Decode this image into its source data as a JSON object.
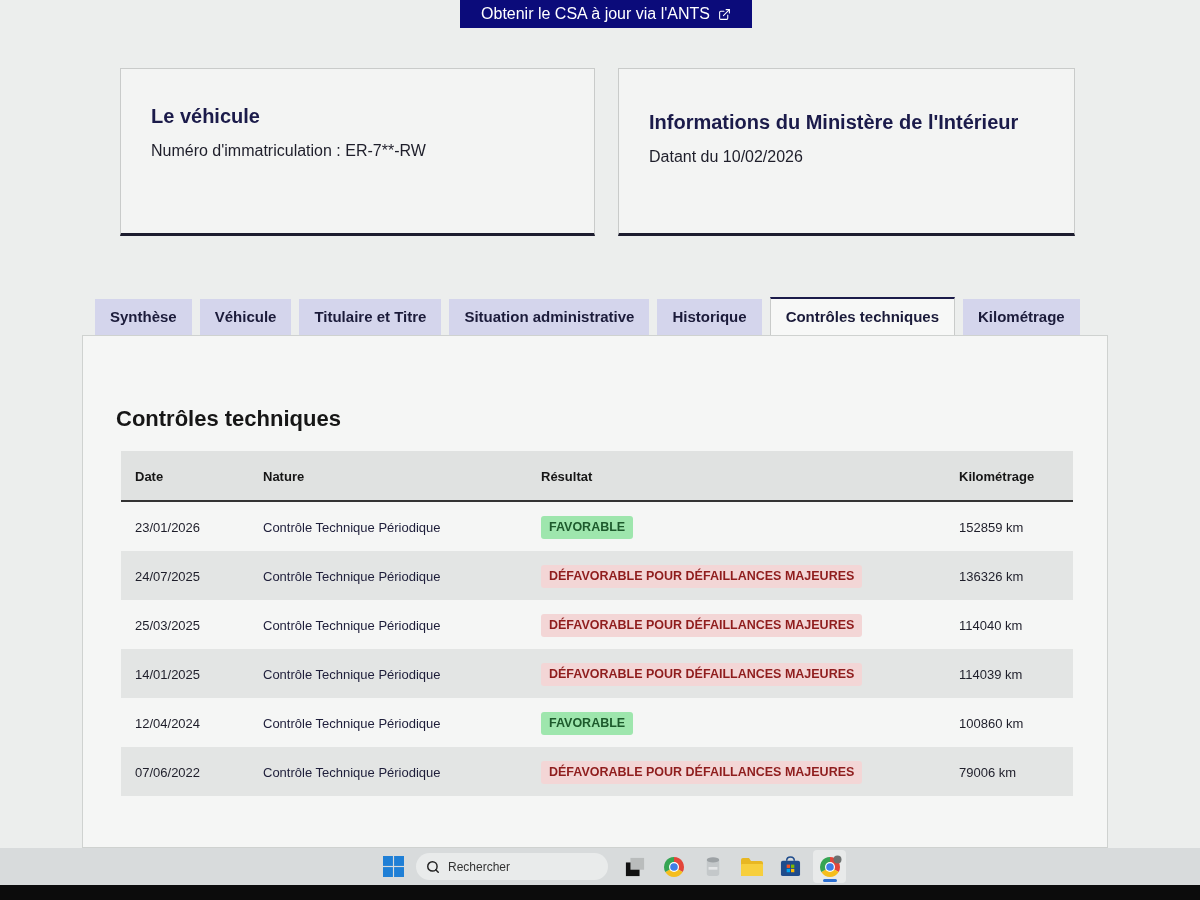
{
  "header_button": {
    "label": "Obtenir le CSA à jour via l'ANTS"
  },
  "cards": [
    {
      "title": "Le véhicule",
      "text": "Numéro d'immatriculation : ER-7**-RW"
    },
    {
      "title": "Informations du Ministère de l'Intérieur",
      "text": "Datant du 10/02/2026"
    }
  ],
  "tabs": [
    {
      "label": "Synthèse",
      "selected": false
    },
    {
      "label": "Véhicule",
      "selected": false
    },
    {
      "label": "Titulaire et Titre",
      "selected": false
    },
    {
      "label": "Situation administrative",
      "selected": false
    },
    {
      "label": "Historique",
      "selected": false
    },
    {
      "label": "Contrôles techniques",
      "selected": true
    },
    {
      "label": "Kilométrage",
      "selected": false
    }
  ],
  "panel": {
    "title": "Contrôles techniques",
    "table": {
      "columns": [
        "Date",
        "Nature",
        "Résultat",
        "Kilométrage"
      ],
      "rows": [
        {
          "date": "23/01/2026",
          "nature": "Contrôle Technique Périodique",
          "result": {
            "label": "FAVORABLE",
            "kind": "favorable"
          },
          "mileage": "152859 km"
        },
        {
          "date": "24/07/2025",
          "nature": "Contrôle Technique Périodique",
          "result": {
            "label": "DÉFAVORABLE POUR DÉFAILLANCES MAJEURES",
            "kind": "unfavorable"
          },
          "mileage": "136326 km"
        },
        {
          "date": "25/03/2025",
          "nature": "Contrôle Technique Périodique",
          "result": {
            "label": "DÉFAVORABLE POUR DÉFAILLANCES MAJEURES",
            "kind": "unfavorable"
          },
          "mileage": "114040 km"
        },
        {
          "date": "14/01/2025",
          "nature": "Contrôle Technique Périodique",
          "result": {
            "label": "DÉFAVORABLE POUR DÉFAILLANCES MAJEURES",
            "kind": "unfavorable"
          },
          "mileage": "114039 km"
        },
        {
          "date": "12/04/2024",
          "nature": "Contrôle Technique Périodique",
          "result": {
            "label": "FAVORABLE",
            "kind": "favorable"
          },
          "mileage": "100860 km"
        },
        {
          "date": "07/06/2022",
          "nature": "Contrôle Technique Périodique",
          "result": {
            "label": "DÉFAVORABLE POUR DÉFAILLANCES MAJEURES",
            "kind": "unfavorable"
          },
          "mileage": "79006 km"
        }
      ]
    }
  },
  "taskbar": {
    "search": {
      "placeholder": "Rechercher"
    },
    "apps": [
      {
        "kind": "task-view",
        "active": false
      },
      {
        "kind": "browser",
        "active": false
      },
      {
        "kind": "cylinder",
        "active": false
      },
      {
        "kind": "folder",
        "active": false
      },
      {
        "kind": "store",
        "active": false
      },
      {
        "kind": "browser-profile",
        "active": true
      }
    ]
  }
}
